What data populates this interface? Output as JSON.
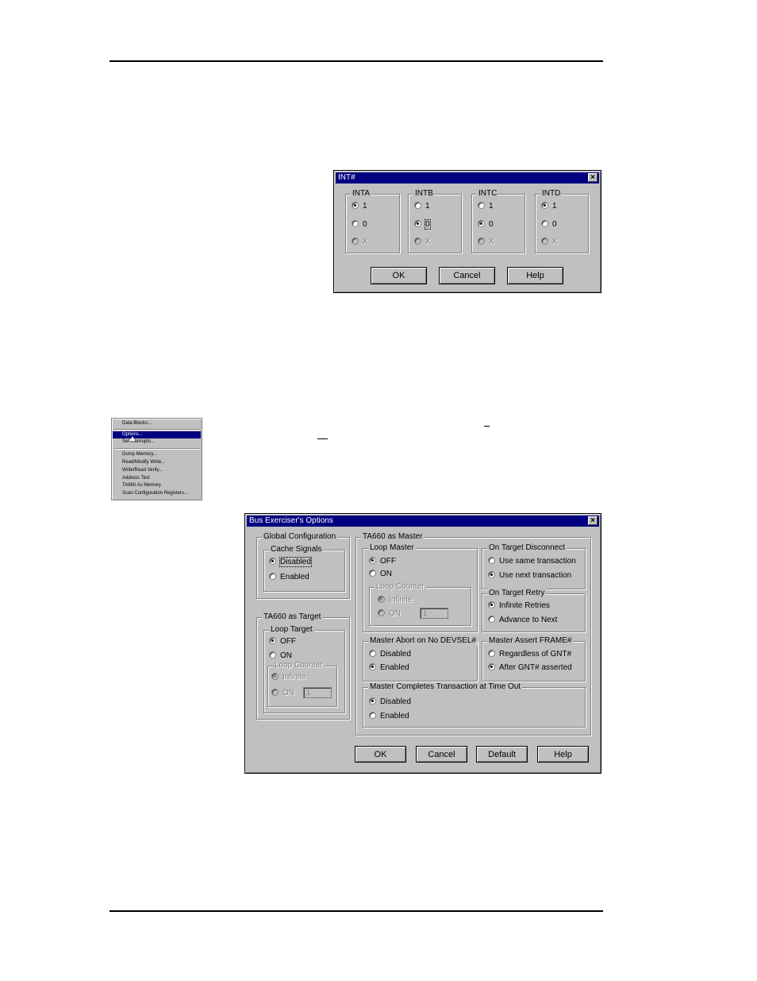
{
  "int_dialog": {
    "title": "INT#",
    "close_glyph": "×",
    "groups": [
      {
        "label": "INTA",
        "options": [
          {
            "label": "1",
            "checked": true,
            "disabled": false
          },
          {
            "label": "0",
            "checked": false,
            "disabled": false
          },
          {
            "label": "X",
            "checked": false,
            "disabled": true
          }
        ]
      },
      {
        "label": "INTB",
        "options": [
          {
            "label": "1",
            "checked": false,
            "disabled": false
          },
          {
            "label": "0",
            "checked": true,
            "disabled": false
          },
          {
            "label": "X",
            "checked": false,
            "disabled": true
          }
        ]
      },
      {
        "label": "INTC",
        "options": [
          {
            "label": "1",
            "checked": false,
            "disabled": false
          },
          {
            "label": "0",
            "checked": true,
            "disabled": false
          },
          {
            "label": "X",
            "checked": false,
            "disabled": true
          }
        ]
      },
      {
        "label": "INTD",
        "options": [
          {
            "label": "1",
            "checked": true,
            "disabled": false
          },
          {
            "label": "0",
            "checked": false,
            "disabled": false
          },
          {
            "label": "X",
            "checked": false,
            "disabled": true
          }
        ]
      }
    ],
    "buttons": {
      "ok": "OK",
      "cancel": "Cancel",
      "help": "Help"
    }
  },
  "context_menu": {
    "items": [
      "Data Blocks...",
      "Options...",
      "Set Interrupts...",
      "Dump Memory...",
      "Read/Modify Write...",
      "Write/Read Verify...",
      "Address Test",
      "TA660 As Memory",
      "Scan Configuration Registers..."
    ],
    "selected": "Options..."
  },
  "options_dialog": {
    "title": "Bus Exerciser's Options",
    "close_glyph": "×",
    "global_configuration": {
      "label": "Global Configuration",
      "cache_signals": {
        "label": "Cache Signals",
        "disabled": "Disabled",
        "enabled": "Enabled",
        "selected": "Disabled"
      }
    },
    "target": {
      "label": "TA660 as Target",
      "loop_target": {
        "label": "Loop Target",
        "off": "OFF",
        "on": "ON",
        "selected": "OFF"
      },
      "loop_counter": {
        "label": "Loop Counter",
        "infinite": "Infinite",
        "on": "ON",
        "value": "1"
      }
    },
    "master": {
      "label": "TA660 as Master",
      "loop_master": {
        "label": "Loop Master",
        "off": "OFF",
        "on": "ON",
        "selected": "OFF"
      },
      "loop_counter": {
        "label": "Loop Counter",
        "infinite": "Infinite",
        "on": "ON",
        "value": "1"
      },
      "on_target_disconnect": {
        "label": "On Target Disconnect",
        "same": "Use same transaction",
        "next": "Use next transaction",
        "selected": "next"
      },
      "on_target_retry": {
        "label": "On Target Retry",
        "infinite": "Infinite Retries",
        "advance": "Advance to Next",
        "selected": "infinite"
      },
      "master_abort": {
        "label": "Master Abort on No DEVSEL#",
        "disabled": "Disabled",
        "enabled": "Enabled",
        "selected": "enabled"
      },
      "master_assert_frame": {
        "label": "Master Assert FRAME#",
        "regardless": "Regardless of GNT#",
        "after": "After GNT# asserted",
        "selected": "after"
      },
      "master_completes": {
        "label": "Master Completes Transaction at Time Out",
        "disabled": "Disabled",
        "enabled": "Enabled",
        "selected": "disabled"
      }
    },
    "buttons": {
      "ok": "OK",
      "cancel": "Cancel",
      "default": "Default",
      "help": "Help"
    }
  }
}
